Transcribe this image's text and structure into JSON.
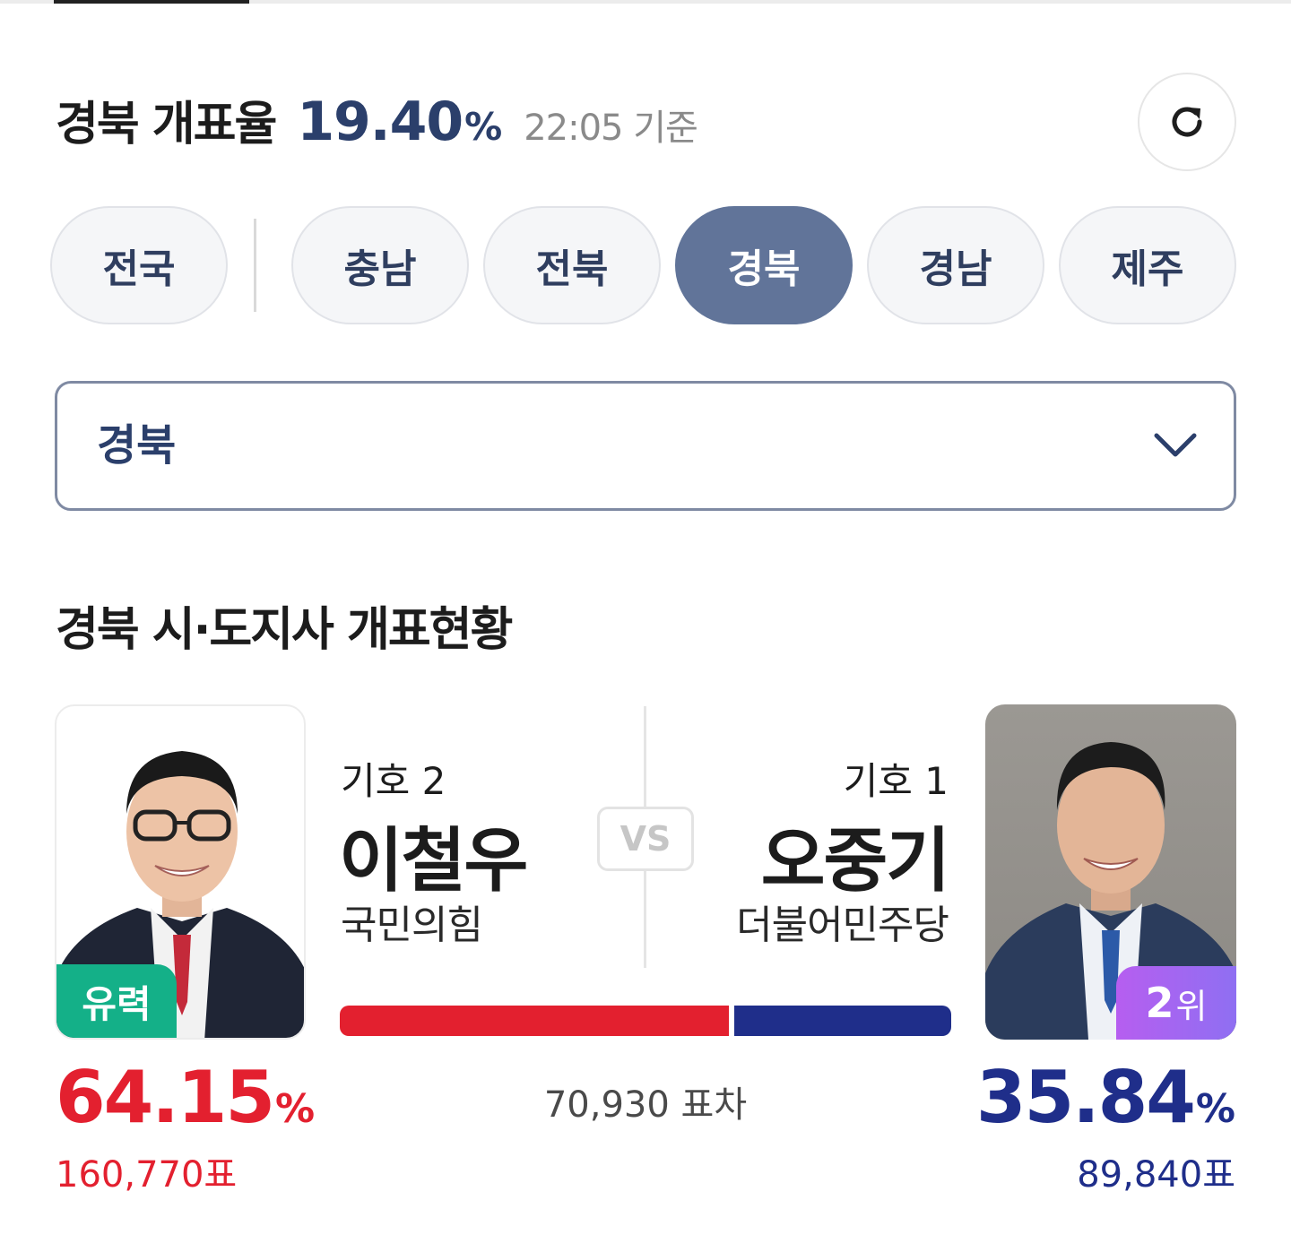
{
  "header": {
    "title": "경북 개표율",
    "count_rate": "19.40",
    "percent_sign": "%",
    "time": "22:05 기준"
  },
  "region_tabs": [
    {
      "label": "전국",
      "active": false
    },
    {
      "label": "충남",
      "active": false
    },
    {
      "label": "전북",
      "active": false
    },
    {
      "label": "경북",
      "active": true
    },
    {
      "label": "경남",
      "active": false
    },
    {
      "label": "제주",
      "active": false
    }
  ],
  "dropdown": {
    "selected": "경북"
  },
  "section_title": "경북 시·도지사 개표현황",
  "vs_label": "VS",
  "candidates": {
    "left": {
      "number": "기호 2",
      "name": "이철우",
      "party": "국민의힘",
      "badge": "유력",
      "percent": "64.15",
      "percent_sign": "%",
      "votes": "160,770표",
      "share": 64.15,
      "color": "#e3202f"
    },
    "right": {
      "number": "기호 1",
      "name": "오중기",
      "party": "더불어민주당",
      "badge_num": "2",
      "badge_suffix": "위",
      "percent": "35.84",
      "percent_sign": "%",
      "votes": "89,840표",
      "share": 35.84,
      "color": "#1f2e8a"
    }
  },
  "vote_margin": "70,930 표차",
  "icons": {
    "refresh": "refresh-icon",
    "dropdown": "chevron-down-icon"
  },
  "colors": {
    "accent": "#2b3f6b",
    "active_tab": "#617499",
    "leading_badge": "#14b088"
  }
}
